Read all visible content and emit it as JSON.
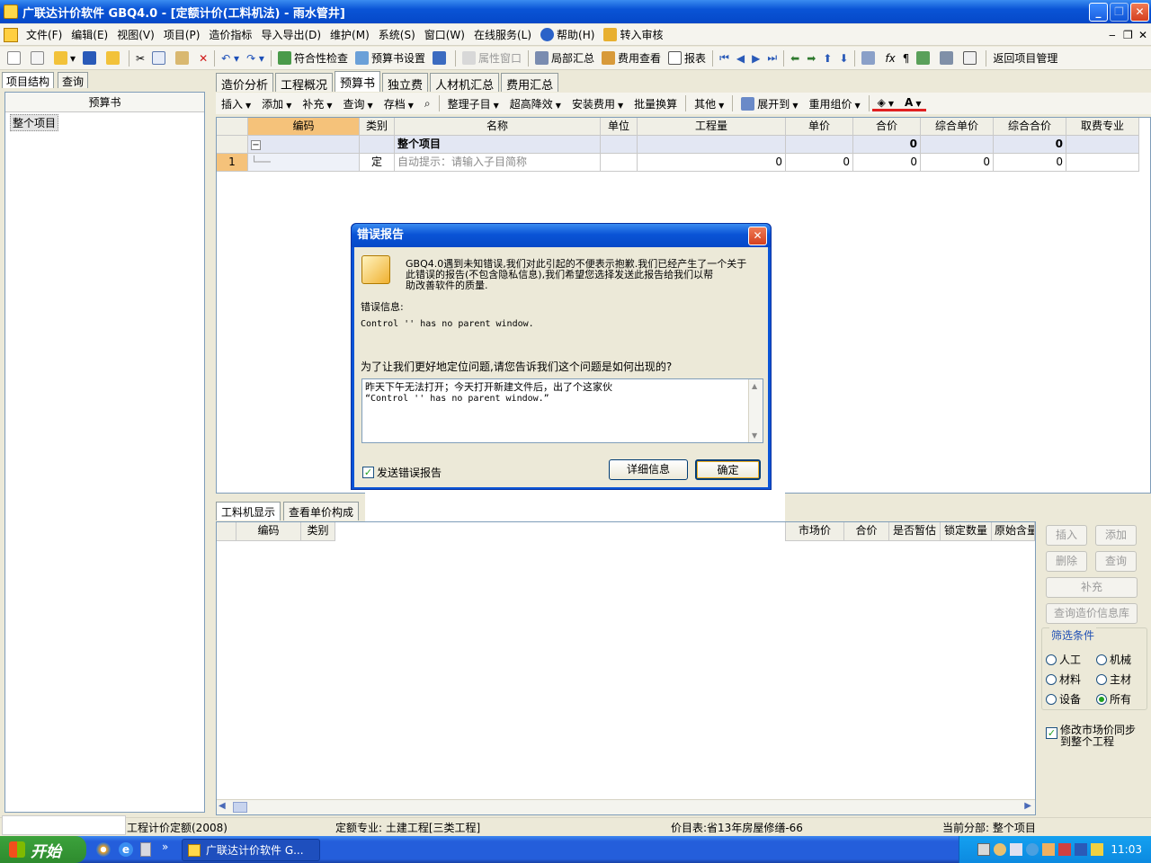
{
  "window": {
    "title": "广联达计价软件 GBQ4.0 - [定额计价(工料机法) - 雨水管井]",
    "min": "_",
    "restore": "❐",
    "close": "✕"
  },
  "menu": [
    "文件(F)",
    "编辑(E)",
    "视图(V)",
    "项目(P)",
    "造价指标",
    "导入导出(D)",
    "维护(M)",
    "系统(S)",
    "窗口(W)",
    "在线服务(L)",
    "帮助(H)",
    "转入审核"
  ],
  "menu_right": [
    "‒",
    "❐",
    "✕"
  ],
  "toolbar": {
    "items": [
      "符合性检查",
      "预算书设置",
      "属性窗口",
      "局部汇总",
      "费用查看",
      "报表",
      "返回项目管理"
    ]
  },
  "left": {
    "tabs": [
      "项目结构",
      "查询"
    ],
    "header": "预算书",
    "node": "整个项目"
  },
  "main_tabs": [
    "造价分析",
    "工程概况",
    "预算书",
    "独立费",
    "人材机汇总",
    "费用汇总"
  ],
  "sub_toolbar": [
    "插入",
    "添加",
    "补充",
    "查询",
    "存档",
    "整理子目",
    "超高降效",
    "安装费用",
    "批量换算",
    "其他",
    "展开到",
    "重用组价"
  ],
  "grid": {
    "headers": [
      "编码",
      "类别",
      "名称",
      "单位",
      "工程量",
      "单价",
      "合价",
      "综合单价",
      "综合合价",
      "取费专业"
    ],
    "group_row": {
      "name": "整个项目",
      "total": "0",
      "comp_total": "0",
      "collapse": "−"
    },
    "row1": {
      "num": "1",
      "type": "定",
      "name": "自动提示：请输入子目简称",
      "qty": "0",
      "price": "0",
      "total": "0",
      "comp_price": "0",
      "comp_total": "0"
    }
  },
  "bottom": {
    "tabs": [
      "工料机显示",
      "查看单价构成"
    ],
    "headers_left": [
      "编码",
      "类别"
    ],
    "headers_right": [
      "市场价",
      "合价",
      "是否暂估",
      "锁定数量",
      "原始含量"
    ]
  },
  "right_panel": {
    "buttons": [
      "插入",
      "添加",
      "删除",
      "查询",
      "补充",
      "查询造价信息库"
    ],
    "filter_title": "筛选条件",
    "radios": [
      "人工",
      "机械",
      "材料",
      "主材",
      "设备",
      "所有"
    ],
    "sync_label": "修改市场价同步到整个工程"
  },
  "status": {
    "s1": "工程计价定额(2008)",
    "s2": "定额专业: 土建工程[三类工程]",
    "s3": "价目表:省13年房屋修缮-66",
    "s4": "当前分部: 整个项目"
  },
  "taskbar": {
    "start": "开始",
    "item": "广联达计价软件 G...",
    "time": "11:03"
  },
  "dialog": {
    "title": "错误报告",
    "intro_line1": "GBQ4.0遇到未知错误,我们对此引起的不便表示抱歉.我们已经产生了一个关于",
    "intro_line2": "此错误的报告(不包含隐私信息),我们希望您选择发送此报告给我们以帮",
    "intro_line3": "助改善软件的质量.",
    "error_label": "错误信息:",
    "error_msg": "Control '' has no parent window.",
    "question": "为了让我们更好地定位问题,请您告诉我们这个问题是如何出现的?",
    "user_text_line1": "昨天下午无法打开；今天打开新建文件后，出了个这家伙",
    "user_text_line2": "“Control '' has no parent window.”",
    "send_report": "发送错误报告",
    "details_btn": "详细信息",
    "ok_btn": "确定"
  }
}
